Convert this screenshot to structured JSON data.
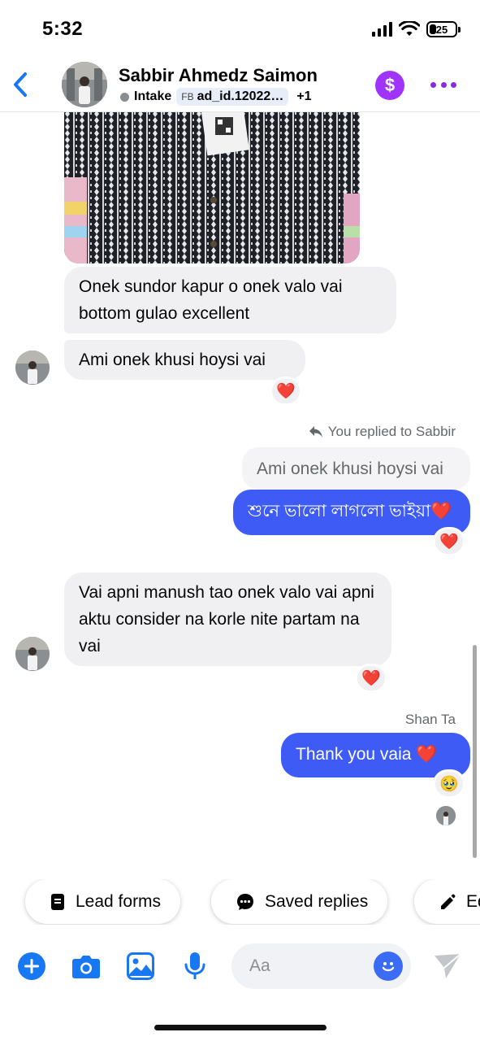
{
  "status_bar": {
    "time": "5:32",
    "battery": "25"
  },
  "header": {
    "name": "Sabbir Ahmedz Saimon",
    "status_label": "Intake",
    "fb_label": "FB",
    "ad_id": "ad_id.12022…",
    "extra_tags": "+1",
    "dollar_symbol": "$"
  },
  "messages": {
    "in1_text": "Onek sundor kapur o onek valo vai bottom gulao excellent",
    "in2_text": "Ami onek khusi hoysi vai",
    "reply_note": "You replied to Sabbir",
    "quoted_text": "Ami onek khusi hoysi vai",
    "out1_text": "শুনে ভালো লাগলো ভাইয়া❤️",
    "in3_text": "Vai apni manush tao onek valo vai apni aktu consider na korle nite partam na vai",
    "sender_label": "Shan Ta",
    "out2_text": "Thank you vaia ❤️",
    "reaction_heart": "❤️",
    "reaction_tear": "🥹"
  },
  "quick_actions": {
    "lead_forms": "Lead forms",
    "saved_replies": "Saved replies",
    "edit_partial": "Ed"
  },
  "composer": {
    "placeholder": "Aa"
  },
  "colors": {
    "accent": "#3e5cf5",
    "incoming_bg": "#f0f0f3",
    "icon_blue": "#1877f2",
    "dollar_purple": "#a033ff"
  }
}
